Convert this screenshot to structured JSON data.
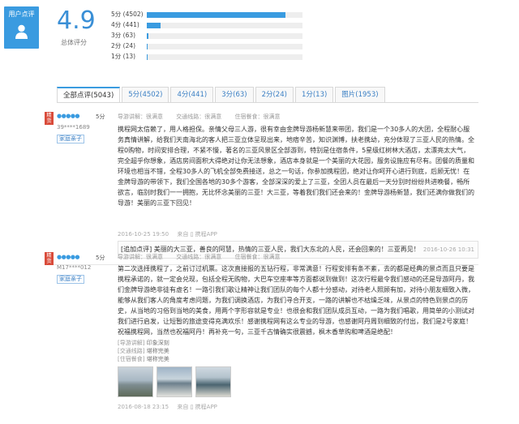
{
  "summary": {
    "badge_label": "用户点评",
    "score": "4.9",
    "score_label": "总体评分",
    "distribution": [
      {
        "label": "5分 (4502)",
        "count": 4502
      },
      {
        "label": "4分 (441)",
        "count": 441
      },
      {
        "label": "3分 (63)",
        "count": 63
      },
      {
        "label": "2分 (24)",
        "count": 24
      },
      {
        "label": "1分 (13)",
        "count": 13
      }
    ],
    "bar_color": "#3a9be0"
  },
  "tabs": [
    {
      "label": "全部点评(5043)",
      "active": true
    },
    {
      "label": "5分(4502)",
      "active": false
    },
    {
      "label": "4分(441)",
      "active": false
    },
    {
      "label": "3分(63)",
      "active": false
    },
    {
      "label": "2分(24)",
      "active": false
    },
    {
      "label": "1分(13)",
      "active": false
    },
    {
      "label": "图片(1953)",
      "active": false
    }
  ],
  "reviews": [
    {
      "tag": "精货",
      "stars": "●●●●●",
      "score": "5分",
      "user": "39****1689",
      "user_type": "家庭亲子",
      "subscores": [
        "导游讲解：很满意",
        "交通线路：很满意",
        "住宿餐食：很满意"
      ],
      "text": "携程网太信赖了，用人格担保。亲情父母三人游，很有幸由金牌导游杨新慧来带团，我们是一个30多人的大团，全程耐心服务真情讲解，给我们天南海北的客人把三亚立体呈现出来，地痞辛苦，知识渊博，扶老携幼，充分体现了三亚人民的热情。全程0购物，时间安排合理，不紧不慢，著名的三亚风景区全部游到，特别是住宿条件，5星级红树林大酒店，太漂亮太大气，完全超乎你想象，酒店房间面积大得绝对让你无法想象，酒店本身就是一个美丽的大花园，服务设施应有尽有。团餐的质量和环境也相当不错，全程30多人的飞机全部免费接送，总之一句话，你参加携程团，绝对让你呵开心进行到底，后顾无忧！在金牌导游的带领下，我们全国各地的30多个游客，全部深深的爱上了三亚，全团人员在最后一天分别时纷纷共进晚餐，畅所欲言，临别时我们一一拥抱，无比怀念美丽的三亚！大三亚，等着我们我们还会来的！金牌导游杨新慧，我们还满你做我们的导游！美丽的三亚下回见！",
      "date": "2016-10-25 19:50",
      "source": "来自",
      "app": "携程APP",
      "followup": "[追加点评] 美丽的大三亚，善良的阿慧，热情的三亚人民，我们大东北的人民，还会回来的！三亚再见！",
      "followup_date": "2016-10-26 10:31"
    },
    {
      "tag": "精货",
      "stars": "●●●●●",
      "score": "5分",
      "user": "M17****012",
      "user_type": "家庭亲子",
      "subscores": [
        "导游讲解：很满意",
        "交通线路：很满意",
        "住宿餐食：很满意"
      ],
      "text": "第二次选择携程了，之前订过机票。这次直接报的五钻行程，非常满意！行程安排有条不紊，去的都是经典的景点而且只要是携程承诺的，就一定会兑现，包括全程无购物，大巴车空座率等方面都说到做到！这次行程最令我们感动的还是导游阿丹，我们金牌导游绝非徒有虚名！一路引我们歌让精神让我们团队的每个人都十分感动，对待老人照顾有加，对待小朋友细致入微，能够从我们客人的角度考虑问题，为我们调换酒店，为我们寻合开支，一路的讲解也不枯燥乏味，从景点的特色到景点的历史，从当地的习俗到当地的美食，用两个字形容就是专业！也很会和我们团队成员互动，一路为我们唱歌，用简单的小测试对我们进行启发，让短暂的旅途变得充满欢乐！感谢携程网有这么专业的导游，也感谢阿丹周到细致的付出，我们是2号家庭！祝福携程网，当然也祝福阿丹！再补充一句，三亚千古情确实很震撼，枫木香草购和啤酒是绝配！",
      "details": [
        {
          "k": "[导游讲解]",
          "v": "印象深刻"
        },
        {
          "k": "[交通线路]",
          "v": "堪称完美"
        },
        {
          "k": "[住宿餐食]",
          "v": "堪称完美"
        }
      ],
      "date": "2016-08-18 23:15",
      "source": "来自",
      "app": "携程APP"
    }
  ]
}
